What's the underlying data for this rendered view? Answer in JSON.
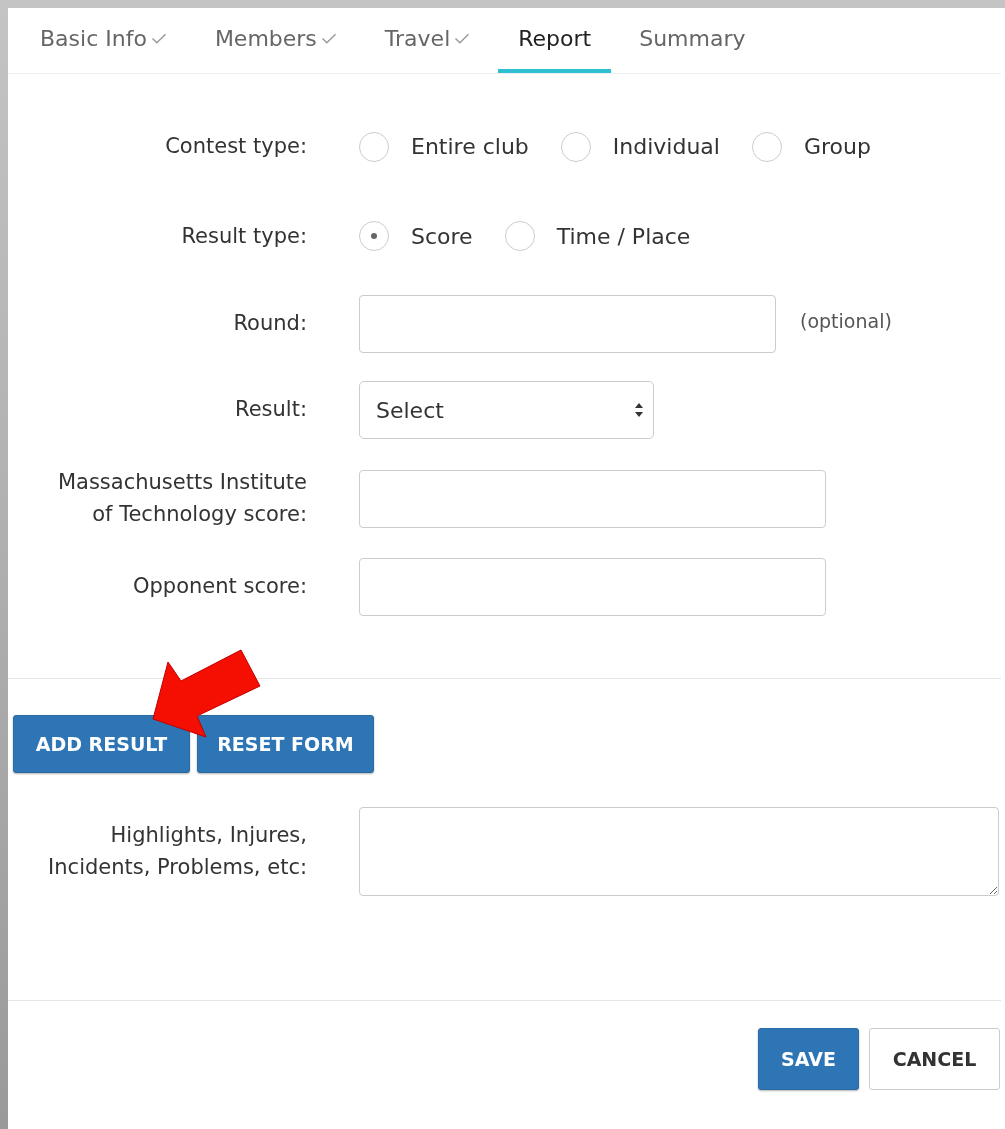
{
  "tabs": [
    {
      "label": "Basic Info",
      "completed": true,
      "selected": false
    },
    {
      "label": "Members",
      "completed": true,
      "selected": false
    },
    {
      "label": "Travel",
      "completed": true,
      "selected": false
    },
    {
      "label": "Report",
      "completed": false,
      "selected": true
    },
    {
      "label": "Summary",
      "completed": false,
      "selected": false
    }
  ],
  "form": {
    "rows": [
      {
        "kind": "radio",
        "label": "Contest type:",
        "options": [
          {
            "label": "Entire club",
            "selected": false
          },
          {
            "label": "Individual",
            "selected": false
          },
          {
            "label": "Group",
            "selected": false
          }
        ]
      },
      {
        "kind": "radio",
        "label": "Result type:",
        "options": [
          {
            "label": "Score",
            "selected": true
          },
          {
            "label": "Time / Place",
            "selected": false
          }
        ]
      },
      {
        "kind": "input",
        "label": "Round:",
        "note": "(optional)"
      },
      {
        "kind": "select",
        "label": "Result:",
        "value": "Select"
      },
      {
        "kind": "wideinput",
        "label": "Massachusetts Institute\nof Technology score:"
      },
      {
        "kind": "wideinput",
        "label": "Opponent score:"
      }
    ]
  },
  "result_buttons": [
    {
      "label": "ADD RESULT"
    },
    {
      "label": "RESET FORM"
    }
  ],
  "notes": {
    "label": "Highlights, Injures,\nIncidents, Problems, etc:"
  },
  "footer_buttons": [
    {
      "label": "SAVE",
      "kind": "primary"
    },
    {
      "label": "CANCEL",
      "kind": "default"
    }
  ]
}
